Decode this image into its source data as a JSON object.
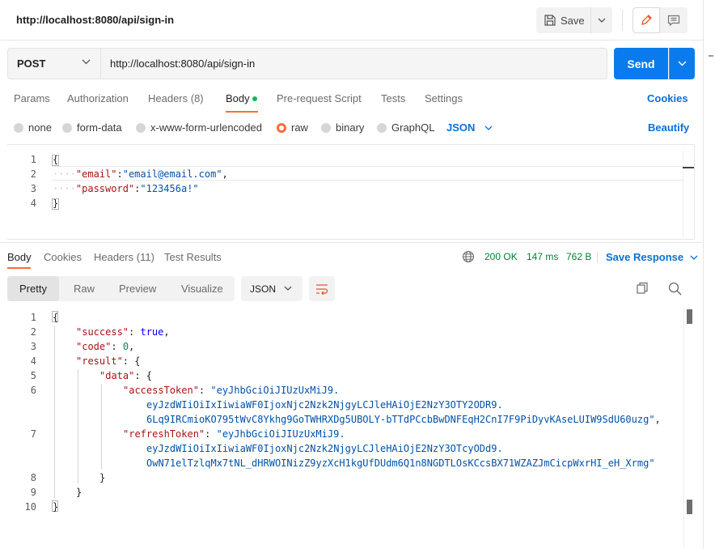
{
  "request": {
    "title": "http://localhost:8080/api/sign-in",
    "save_label": "Save",
    "method": "POST",
    "url": "http://localhost:8080/api/sign-in",
    "send_label": "Send"
  },
  "request_tabs": {
    "params": "Params",
    "authorization": "Authorization",
    "headers": "Headers (8)",
    "body": "Body",
    "pre_request": "Pre-request Script",
    "tests": "Tests",
    "settings": "Settings",
    "cookies": "Cookies"
  },
  "body_types": {
    "none": "none",
    "form_data": "form-data",
    "urlencoded": "x-www-form-urlencoded",
    "raw": "raw",
    "binary": "binary",
    "graphql": "GraphQL",
    "language": "JSON",
    "beautify": "Beautify"
  },
  "request_body": {
    "line_numbers": [
      "1",
      "2",
      "3",
      "4"
    ],
    "open": "{",
    "email_key": "\"email\"",
    "email_value": "\"email@email.com\"",
    "password_key": "\"password\"",
    "password_value": "\"123456a!\"",
    "close": "}"
  },
  "response_tabs": {
    "body": "Body",
    "cookies": "Cookies",
    "headers": "Headers (11)",
    "test_results": "Test Results"
  },
  "response_meta": {
    "status": "200 OK",
    "time": "147 ms",
    "size": "762 B",
    "save_response": "Save Response"
  },
  "response_view": {
    "pretty": "Pretty",
    "raw": "Raw",
    "preview": "Preview",
    "visualize": "Visualize",
    "format": "JSON"
  },
  "response_body": {
    "line_numbers": [
      "1",
      "2",
      "3",
      "4",
      "5",
      "6",
      "",
      "",
      "7",
      "",
      "",
      "8",
      "9",
      "10"
    ],
    "success_key": "\"success\"",
    "success_value": "true",
    "code_key": "\"code\"",
    "code_value": "0",
    "result_key": "\"result\"",
    "data_key": "\"data\"",
    "access_key": "\"accessToken\"",
    "access_value_1": "\"eyJhbGciOiJIUzUxMiJ9.",
    "access_value_2": "eyJzdWIiOiIxIiwiaWF0IjoxNjc2Nzk2NjgyLCJleHAiOjE2NzY3OTY2ODR9.",
    "access_value_3": "6Lq9IRCmioKO795tWvC8Ykhg9GoTWHRXDg5UBOLY-bTTdPCcbBwDNFEqH2CnI7F9PiDyvKAseLUIW9SdU60uzg\"",
    "refresh_key": "\"refreshToken\"",
    "refresh_value_1": "\"eyJhbGciOiJIUzUxMiJ9.",
    "refresh_value_2": "eyJzdWIiOiIxIiwiaWF0IjoxNjc2Nzk2NjgyLCJleHAiOjE2NzY3OTcyODd9.",
    "refresh_value_3": "OwN71elTzlqMx7tNL_dHRWOINizZ9yzXcH1kgUfDUdm6Q1n8NGDTLOsKCcsBX71WZAZJmCicpWxrHI_eH_Xrmg\""
  },
  "colors": {
    "send_button": "#097bed",
    "active_tab_indicator": "#ff6c37",
    "status_ok": "#007f31",
    "link": "#0b6fd5",
    "json_key": "#a31515",
    "json_string": "#0451a5",
    "json_number": "#098658",
    "json_boolean": "#0000ff"
  },
  "icons": [
    "save-icon",
    "pencil-icon",
    "comment-icon",
    "chevron-down-icon",
    "globe-icon",
    "wrap-lines-icon",
    "copy-icon",
    "search-icon"
  ]
}
